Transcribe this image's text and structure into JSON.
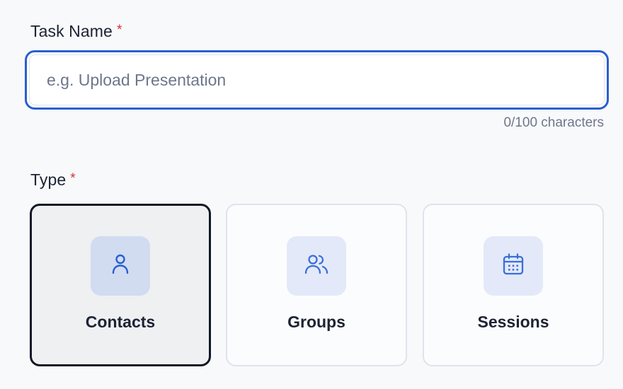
{
  "task_name": {
    "label": "Task Name",
    "required_mark": "*",
    "placeholder": "e.g. Upload Presentation",
    "value": "",
    "counter": "0/100 characters"
  },
  "type": {
    "label": "Type",
    "required_mark": "*",
    "selected": "Contacts",
    "options": [
      {
        "label": "Contacts",
        "icon": "user-icon"
      },
      {
        "label": "Groups",
        "icon": "users-icon"
      },
      {
        "label": "Sessions",
        "icon": "calendar-icon"
      }
    ]
  },
  "colors": {
    "accent": "#2a5fd0",
    "icon": "#2a5fd0",
    "required": "#d93030",
    "selected_border": "#111827"
  }
}
